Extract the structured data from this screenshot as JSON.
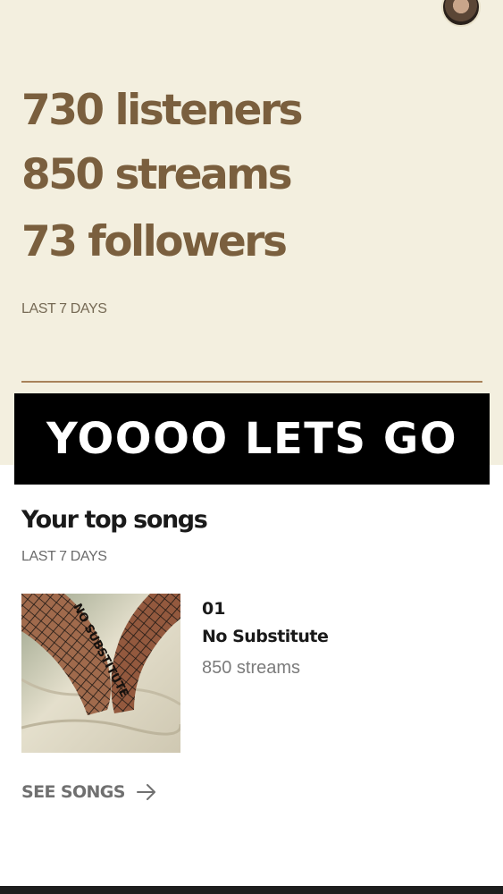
{
  "stats": {
    "listeners": "730 listeners",
    "streams": "850 streams",
    "followers": "73 followers",
    "period": "LAST 7 DAYS"
  },
  "banner": {
    "text": "YOOOO LETS GO"
  },
  "top_songs": {
    "title": "Your top songs",
    "period": "LAST 7 DAYS",
    "songs": [
      {
        "rank": "01",
        "title": "No Substitute",
        "streams": "850 streams",
        "cover_text": "NO SUBSTITUTE"
      }
    ],
    "see_all_label": "SEE SONGS"
  },
  "colors": {
    "panel_bg": "#f3efdf",
    "stat_text": "#7a5f3e",
    "banner_bg": "#000000",
    "banner_text": "#ffffff"
  },
  "icons": {
    "avatar": "profile-avatar",
    "see_songs": "arrow-right-icon"
  }
}
